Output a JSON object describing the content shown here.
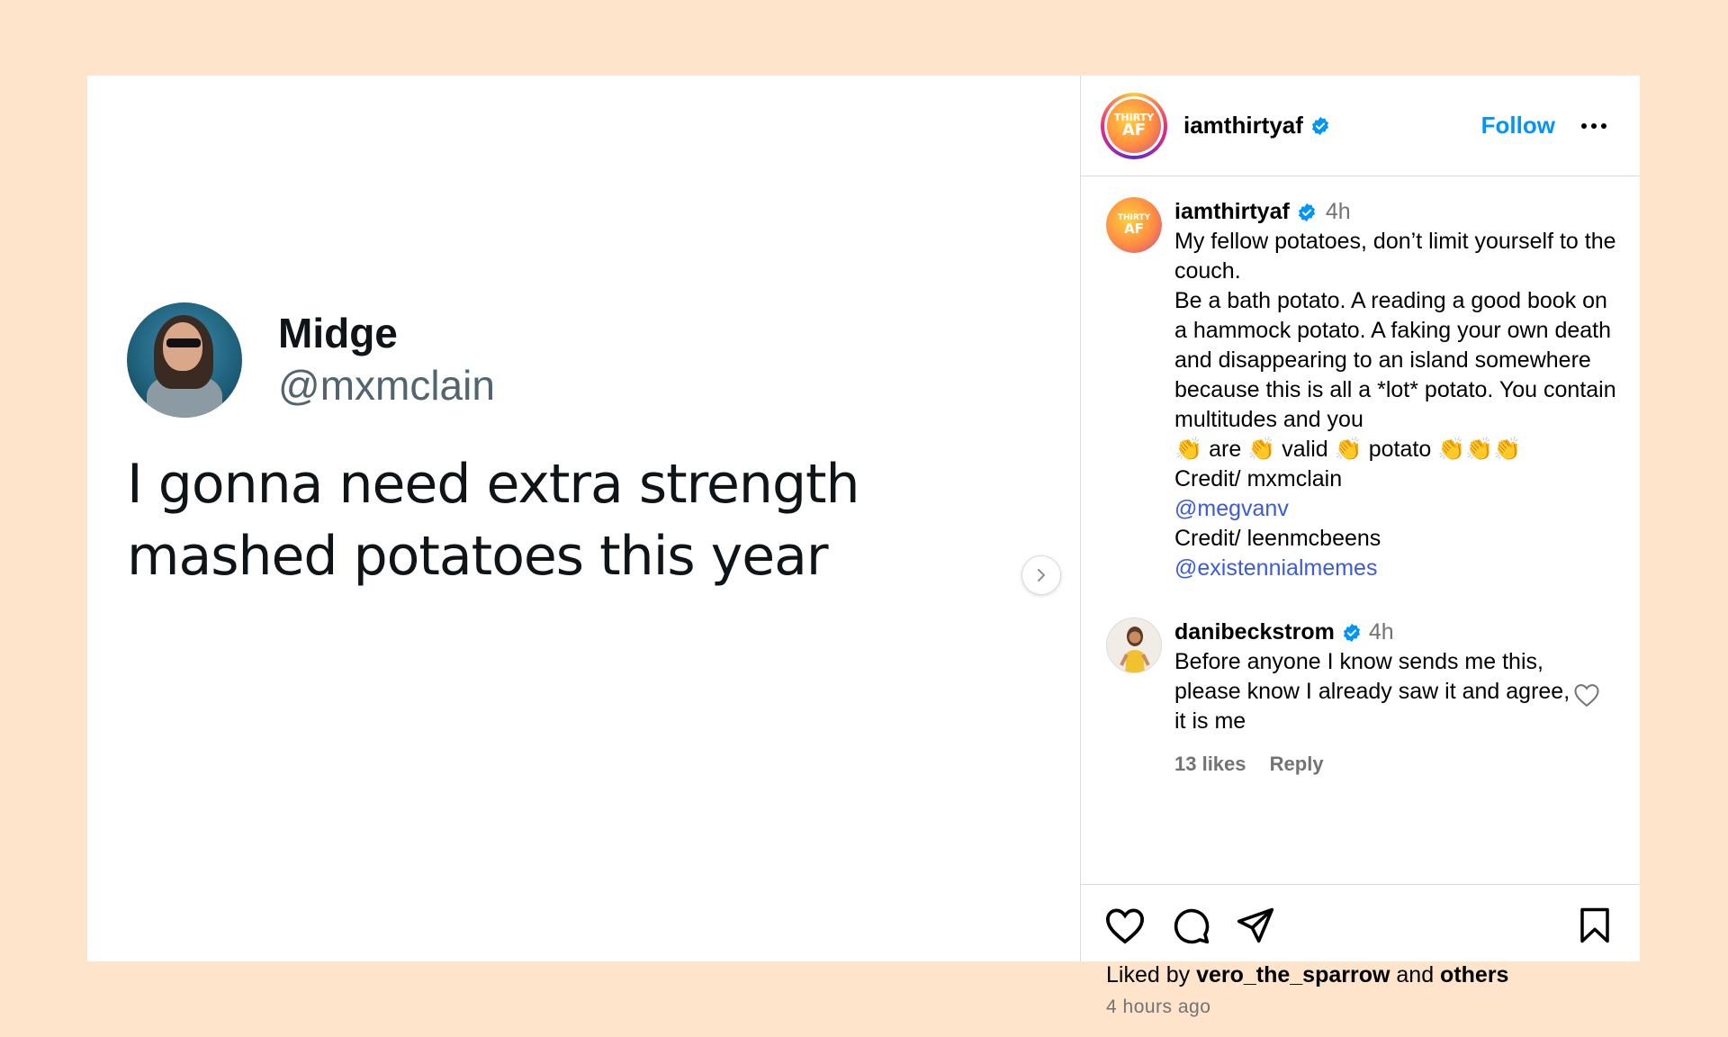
{
  "tweet": {
    "name": "Midge",
    "handle": "@mxmclain",
    "text": "I gonna need extra strength mashed potatoes this year"
  },
  "header": {
    "username": "iamthirtyaf",
    "follow_label": "Follow",
    "logo_top": "THIRTY",
    "logo_bottom": "AF"
  },
  "caption": {
    "username": "iamthirtyaf",
    "time": "4h",
    "text": "My fellow potatoes, don’t limit yourself to the couch.\nBe a bath potato. A reading a good book on a hammock potato. A faking your own death and disappearing to an island somewhere because this is all a *lot* potato. You contain multitudes and you",
    "clap_line": [
      "👏",
      " are ",
      "👏",
      " valid ",
      "👏",
      " potato ",
      "👏👏👏"
    ],
    "credit1": "Credit/ mxmclain",
    "mention1": "@megvanv",
    "credit2": "Credit/ leenmcbeens",
    "mention2": "@existennialmemes"
  },
  "comment": {
    "username": "danibeckstrom",
    "time": "4h",
    "text": "Before anyone I know sends me this, please know I already saw it and agree, it is me",
    "likes": "13 likes",
    "reply": "Reply"
  },
  "footer": {
    "liked_by_prefix": "Liked by ",
    "liked_by_user": "vero_the_sparrow",
    "liked_by_and": " and ",
    "liked_by_others": "others",
    "time_ago": "4 hours ago"
  },
  "colors": {
    "background": "#ffe4cc",
    "link": "#0095f6",
    "verified": "#0095f6",
    "mention": "#3b5bdb"
  }
}
